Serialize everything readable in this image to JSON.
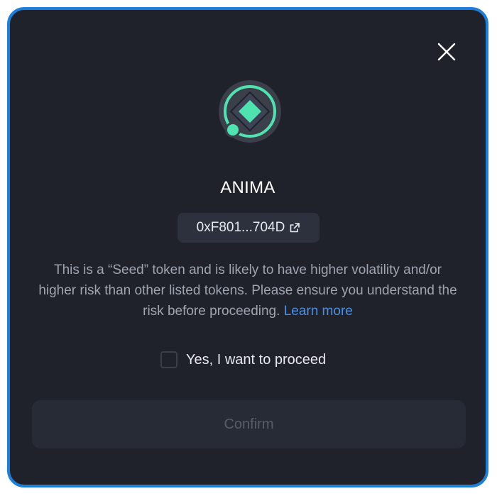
{
  "dialog": {
    "token_name": "ANIMA",
    "address": "0xF801...704D",
    "warning_text": "This is a “Seed” token and is likely to have higher volatility and/or higher risk than other listed tokens. Please ensure you understand the risk before proceeding.",
    "learn_more_label": "Learn more",
    "checkbox_label": "Yes, I want to proceed",
    "checkbox_checked": false,
    "confirm_label": "Confirm",
    "confirm_enabled": false
  },
  "icons": {
    "close": "close-icon",
    "token_logo": "anima-token-logo",
    "external_link": "external-link-icon"
  },
  "colors": {
    "background": "#1f222b",
    "frame_border": "#1d7fd8",
    "accent_link": "#4a90e2",
    "logo_green": "#4fe3b0",
    "chip_background": "#2c313d",
    "button_disabled_bg": "#272b35",
    "button_disabled_text": "#575d69",
    "muted_text": "#9ea4b0"
  }
}
